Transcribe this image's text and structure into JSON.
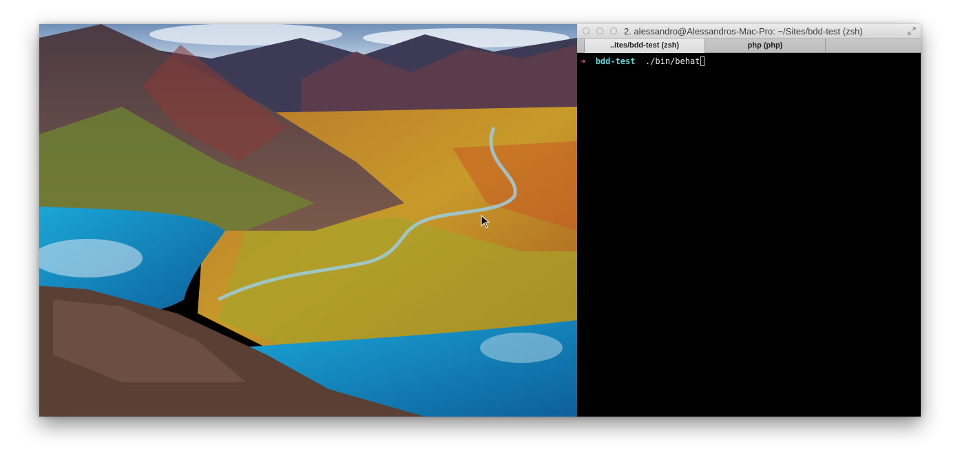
{
  "terminal": {
    "window_title": "2. alessandro@Alessandros-Mac-Pro: ~/Sites/bdd-test (zsh)",
    "tabs": [
      {
        "label": "..ites/bdd-test (zsh)",
        "active": true
      },
      {
        "label": "php (php)",
        "active": false
      },
      {
        "label": "",
        "active": false
      }
    ],
    "prompt": {
      "arrow": "➜",
      "directory": "bdd-test",
      "command": "./bin/behat"
    }
  },
  "desktop": {
    "wallpaper": "landscape-mountains-lake",
    "cursor": "arrow-pointer-icon"
  },
  "colors": {
    "terminal_bg": "#000000",
    "prompt_arrow": "#ff5a5a",
    "prompt_dir": "#62d4d8",
    "command_text": "#e8e8e8"
  }
}
